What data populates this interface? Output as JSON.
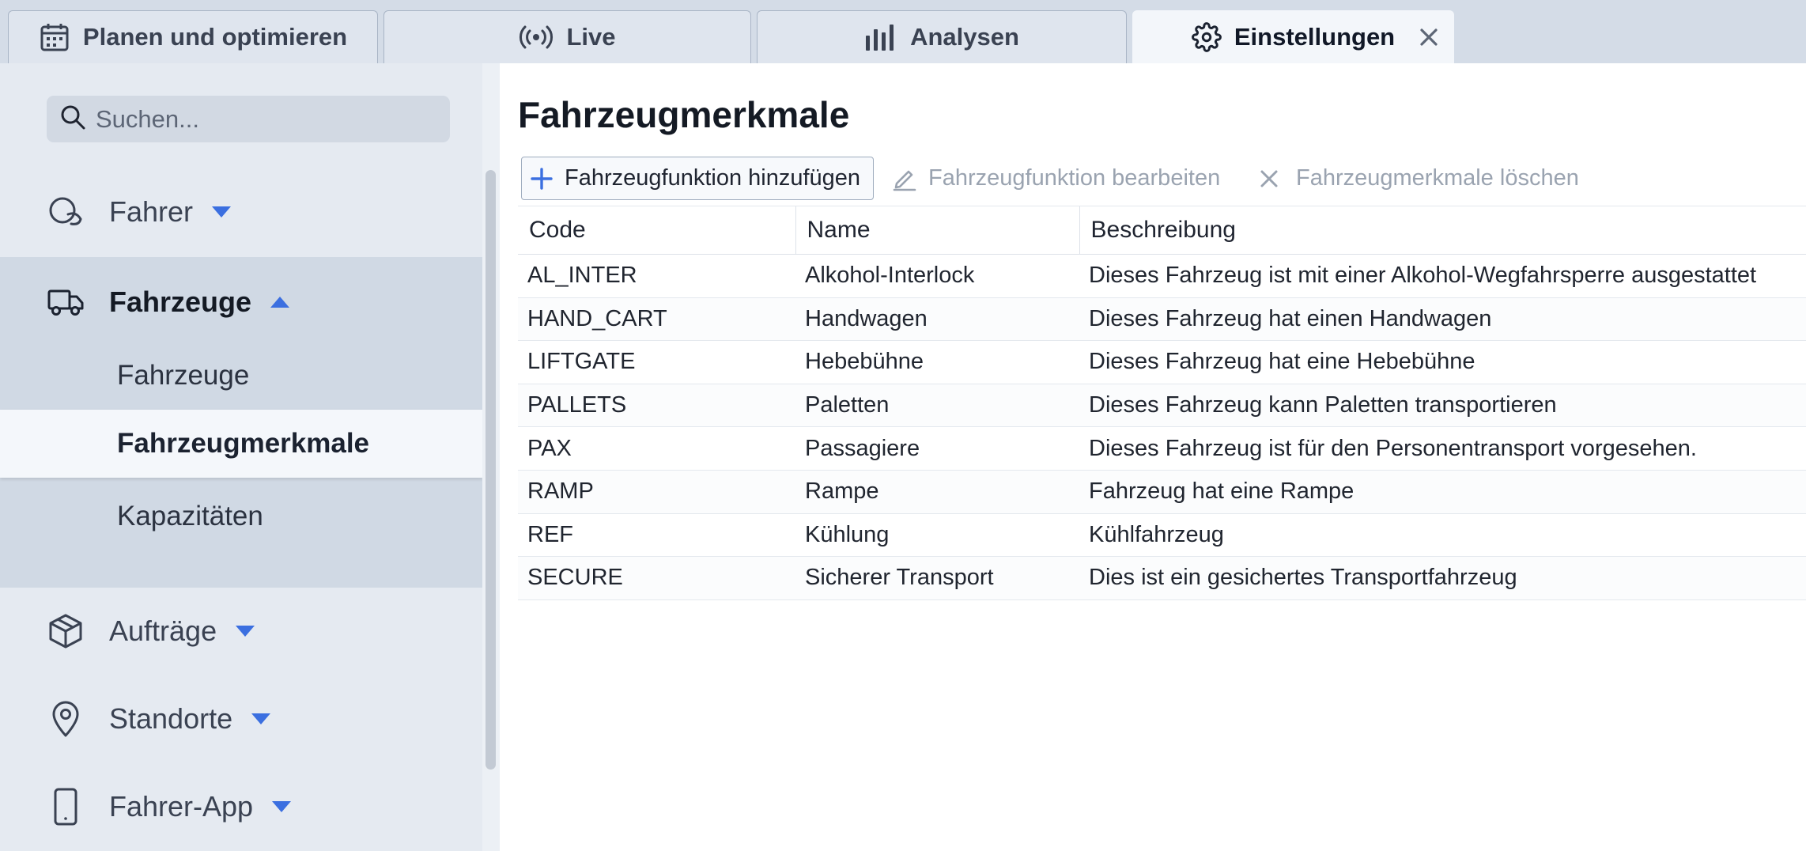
{
  "tabs": [
    {
      "label": "Planen und optimieren",
      "icon": "calendar-icon",
      "active": false
    },
    {
      "label": "Live",
      "icon": "broadcast-icon",
      "active": false
    },
    {
      "label": "Analysen",
      "icon": "bar-chart-icon",
      "active": false
    },
    {
      "label": "Einstellungen",
      "icon": "gear-icon",
      "active": true,
      "closable": true
    }
  ],
  "sidebar": {
    "search_placeholder": "Suchen...",
    "items": [
      {
        "label": "Fahrer",
        "icon": "driver-icon",
        "expanded": false
      },
      {
        "label": "Fahrzeuge",
        "icon": "truck-icon",
        "expanded": true,
        "children": [
          {
            "label": "Fahrzeuge",
            "selected": false
          },
          {
            "label": "Fahrzeugmerkmale",
            "selected": true
          },
          {
            "label": "Kapazitäten",
            "selected": false
          }
        ]
      },
      {
        "label": "Aufträge",
        "icon": "package-icon",
        "expanded": false
      },
      {
        "label": "Standorte",
        "icon": "location-pin-icon",
        "expanded": false
      },
      {
        "label": "Fahrer-App",
        "icon": "mobile-phone-icon",
        "expanded": false
      }
    ]
  },
  "main": {
    "title": "Fahrzeugmerkmale",
    "toolbar": {
      "add_label": "Fahrzeugfunktion hinzufügen",
      "edit_label": "Fahrzeugfunktion bearbeiten",
      "delete_label": "Fahrzeugmerkmale löschen"
    },
    "table": {
      "columns": [
        "Code",
        "Name",
        "Beschreibung"
      ],
      "rows": [
        [
          "AL_INTER",
          "Alkohol-Interlock",
          "Dieses Fahrzeug ist mit einer Alkohol-Wegfahrsperre ausgestattet"
        ],
        [
          "HAND_CART",
          "Handwagen",
          "Dieses Fahrzeug hat einen Handwagen"
        ],
        [
          "LIFTGATE",
          "Hebebühne",
          "Dieses Fahrzeug hat eine Hebebühne"
        ],
        [
          "PALLETS",
          "Paletten",
          "Dieses Fahrzeug kann Paletten transportieren"
        ],
        [
          "PAX",
          "Passagiere",
          "Dieses Fahrzeug ist für den Personentransport vorgesehen."
        ],
        [
          "RAMP",
          "Rampe",
          "Fahrzeug hat eine Rampe"
        ],
        [
          "REF",
          "Kühlung",
          "Kühlfahrzeug"
        ],
        [
          "SECURE",
          "Sicherer Transport",
          "Dies ist ein gesichertes Transportfahrzeug"
        ]
      ]
    }
  },
  "colors": {
    "accent": "#3b6fe0",
    "sidebar_bg": "#e5eaf1",
    "sidebar_group_bg": "#d0d9e4",
    "tab_bar_bg": "#d4dce7",
    "disabled_text": "#9aa3b0"
  }
}
